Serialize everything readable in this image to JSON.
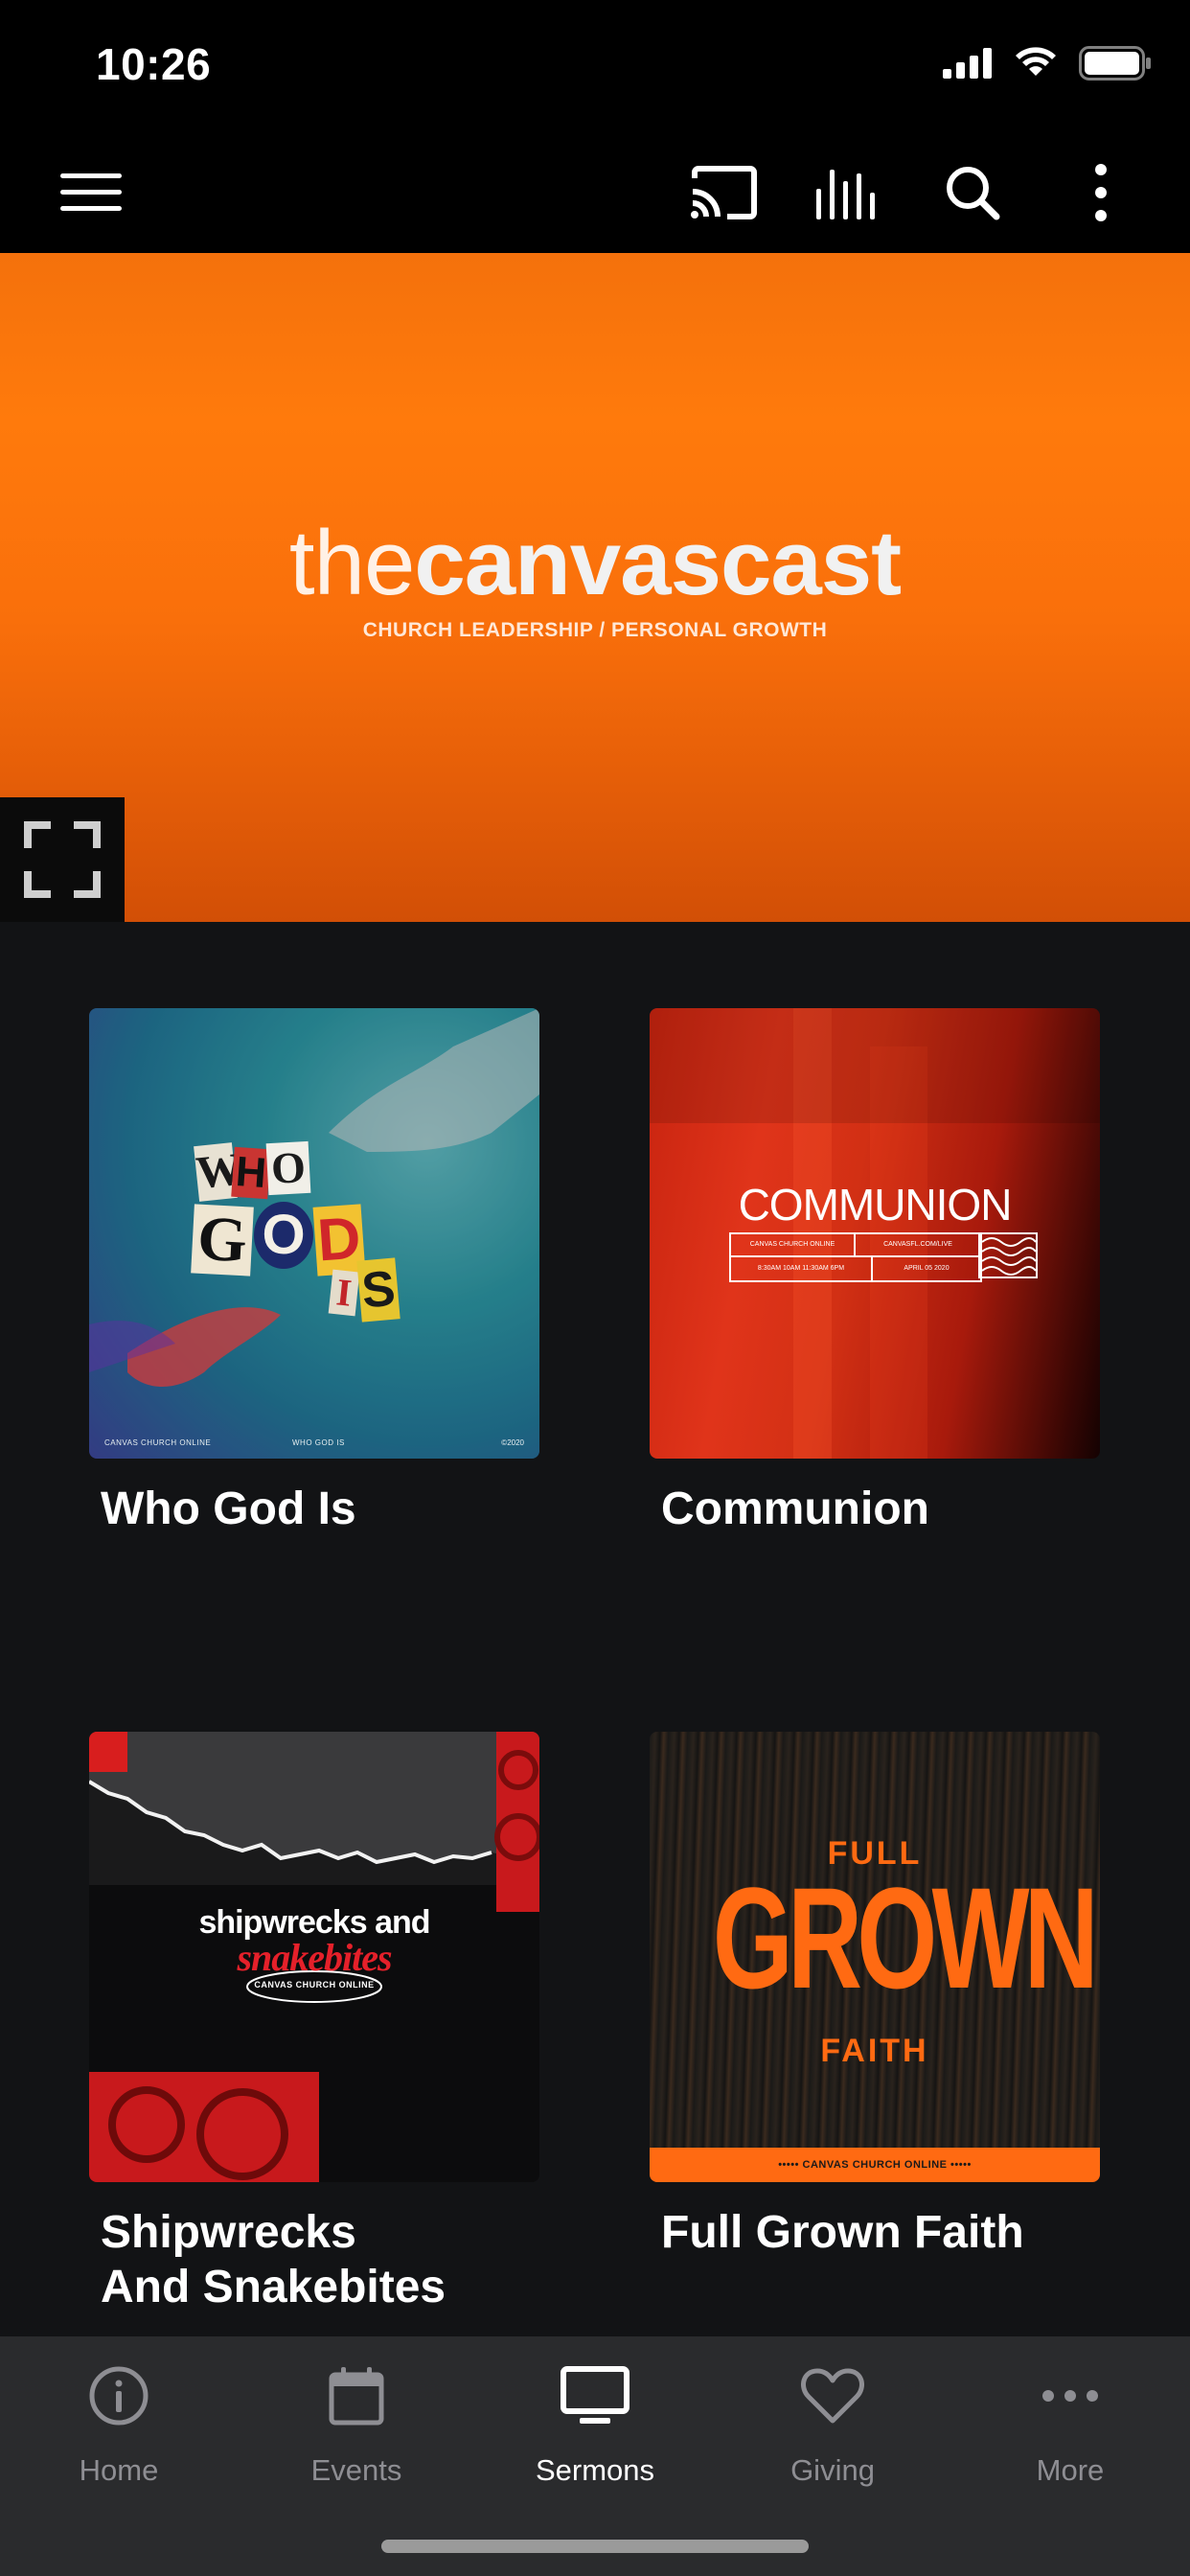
{
  "status_bar": {
    "time": "10:26"
  },
  "hero": {
    "title_light": "the",
    "title_bold": "canvascast",
    "subtitle": "CHURCH LEADERSHIP / PERSONAL GROWTH"
  },
  "sermons": [
    {
      "title": "Who God Is",
      "art": {
        "letters": [
          "W",
          "H",
          "O",
          "G",
          "O",
          "D",
          "I",
          "S"
        ],
        "footer_left": "CANVAS CHURCH ONLINE",
        "footer_mid": "WHO GOD IS",
        "footer_right": "©2020"
      }
    },
    {
      "title": "Communion",
      "art": {
        "heading": "COMMUNION",
        "cells": [
          "CANVAS CHURCH ONLINE",
          "CANVASFL.COM/LIVE",
          "8:30AM   10AM   11:30AM   6PM",
          "APRIL 05 2020"
        ]
      }
    },
    {
      "title": "Shipwrecks\nAnd Snakebites",
      "title_line1": "Shipwrecks",
      "title_line2": "And Snakebites",
      "art": {
        "line1": "shipwrecks and",
        "line2": "snakebites",
        "badge": "CANVAS CHURCH ONLINE"
      }
    },
    {
      "title": "Full Grown Faith",
      "art": {
        "top": "FULL",
        "middle": "GROWN",
        "bottom": "FAITH",
        "strip": "••••• CANVAS CHURCH ONLINE •••••"
      }
    }
  ],
  "tabs": [
    {
      "label": "Home",
      "icon": "info-icon",
      "active": false
    },
    {
      "label": "Events",
      "icon": "calendar-icon",
      "active": false
    },
    {
      "label": "Sermons",
      "icon": "tv-icon",
      "active": true
    },
    {
      "label": "Giving",
      "icon": "heart-icon",
      "active": false
    },
    {
      "label": "More",
      "icon": "more-dots-icon",
      "active": false
    }
  ],
  "colors": {
    "accent_orange": "#ff7a0c",
    "background": "#121315",
    "tabbar": "#2a2b2d",
    "inactive_tab": "#8e8e93"
  }
}
